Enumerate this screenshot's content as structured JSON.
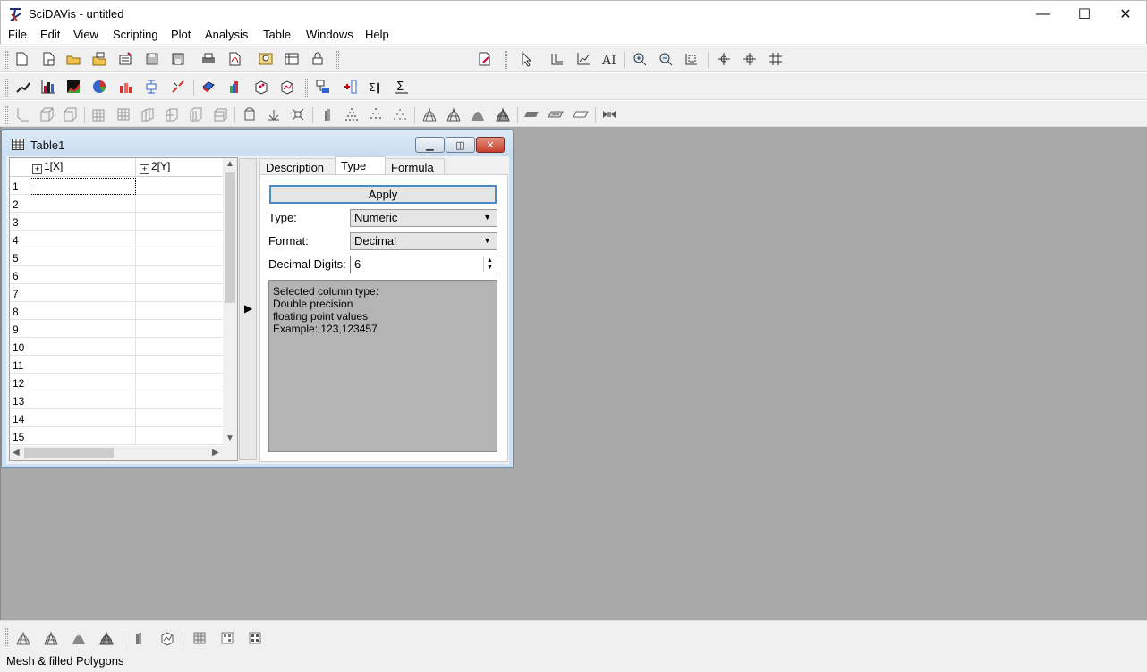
{
  "app": {
    "title": "SciDAVis - untitled",
    "controls": {
      "minimize": "—",
      "maximize": "☐",
      "close": "✕"
    }
  },
  "menu": [
    "File",
    "Edit",
    "View",
    "Scripting",
    "Plot",
    "Analysis",
    "Table",
    "Windows",
    "Help"
  ],
  "toolbar_icons": {
    "row1": [
      "new-project-icon",
      "new-table-icon",
      "open-icon",
      "open-template-icon",
      "import-ascii-icon",
      "save-icon",
      "save-as-icon",
      "print-icon",
      "export-pdf-icon",
      "find-icon",
      "results-log-icon",
      "lock-icon",
      "undo-edit-icon",
      "pointer-icon",
      "layer-icon",
      "axes-icon",
      "text-icon",
      "zoom-in-icon",
      "zoom-out-icon",
      "rescale-icon",
      "data-reader-icon",
      "screen-reader-icon",
      "move-points-icon"
    ],
    "row2": [
      "line-plot-icon",
      "bar-chart-icon",
      "area-plot-icon",
      "pie-chart-icon",
      "stack-bar-icon",
      "box-plot-icon",
      "vector-plot-icon",
      "3d-ribbon-icon",
      "3d-bars-icon",
      "3d-scatter-icon",
      "3d-trajectory-icon",
      "fit-icon",
      "add-column-icon",
      "sum-icon",
      "integrate-icon"
    ],
    "row3": [
      "frame-axes-icon",
      "box-icon",
      "frame-icon",
      "grid-back-icon",
      "grid-left-icon",
      "grid-floor-icon",
      "grid-right-icon",
      "grid-ceil-icon",
      "grid-front-icon",
      "perspective-icon",
      "reset-rotation-icon",
      "fit-frame-icon",
      "bars-icon",
      "points-icon",
      "crosses-icon",
      "cones-icon",
      "wireframe-icon",
      "hidden-line-icon",
      "polygon-icon",
      "filled-mesh-icon",
      "floor-data-icon",
      "floor-iso-icon",
      "floor-empty-icon",
      "anim-icon"
    ],
    "bottom": [
      "wireframe-icon",
      "hidden-line-icon",
      "polygon-icon",
      "filled-mesh-icon",
      "bars-icon",
      "points-icon",
      "floor-data-icon",
      "floor-iso-icon",
      "floor-empty-icon"
    ]
  },
  "table_window": {
    "title": "Table1",
    "columns": [
      "1[X]",
      "2[Y]"
    ],
    "rows": [
      "1",
      "2",
      "3",
      "4",
      "5",
      "6",
      "7",
      "8",
      "9",
      "10",
      "11",
      "12",
      "13",
      "14",
      "15"
    ],
    "tabs": [
      "Description",
      "Type",
      "Formula"
    ],
    "active_tab": "Type",
    "apply_label": "Apply",
    "type_label": "Type:",
    "type_value": "Numeric",
    "format_label": "Format:",
    "format_value": "Decimal",
    "digits_label": "Decimal Digits:",
    "digits_value": "6",
    "description_lines": [
      "Selected column type:",
      "Double precision",
      "floating point values",
      "Example: 123,123457"
    ]
  },
  "status": {
    "text": "Mesh & filled Polygons"
  }
}
